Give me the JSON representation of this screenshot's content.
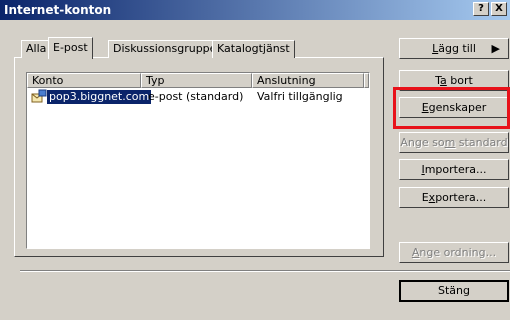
{
  "window": {
    "title": "Internet-konton",
    "help_glyph": "?",
    "close_glyph": "X"
  },
  "tabs": [
    {
      "label": "Alla"
    },
    {
      "label": "E-post"
    },
    {
      "label": "Diskussionsgrupper"
    },
    {
      "label": "Katalogtjänst"
    }
  ],
  "active_tab": "E-post",
  "list": {
    "columns": [
      "Konto",
      "Typ",
      "Anslutning"
    ],
    "rows": [
      {
        "konto": "pop3.biggnet.com",
        "typ": "e-post (standard)",
        "anslutning": "Valfri tillgänglig",
        "selected": true
      }
    ]
  },
  "buttons": {
    "add": {
      "pre": "",
      "key": "L",
      "post": "ägg till",
      "arrow": "▶"
    },
    "remove": {
      "pre": "T",
      "key": "a",
      "post": " bort"
    },
    "properties": {
      "pre": "",
      "key": "E",
      "post": "genskaper"
    },
    "set_default": {
      "pre": "Ange so",
      "key": "m",
      "post": " standard"
    },
    "import": {
      "pre": "",
      "key": "I",
      "post": "mportera..."
    },
    "export": {
      "pre": "E",
      "key": "x",
      "post": "portera..."
    },
    "set_order": {
      "pre": "",
      "key": "A",
      "post": "nge ordning..."
    },
    "close": {
      "label": "Stäng"
    }
  },
  "colors": {
    "highlight": "#e8121a",
    "selection": "#0a246a",
    "title_start": "#0a246a",
    "title_end": "#a6caf0"
  },
  "icons": {
    "account": "mail-account-icon",
    "arrow": "triangle-right-icon"
  }
}
